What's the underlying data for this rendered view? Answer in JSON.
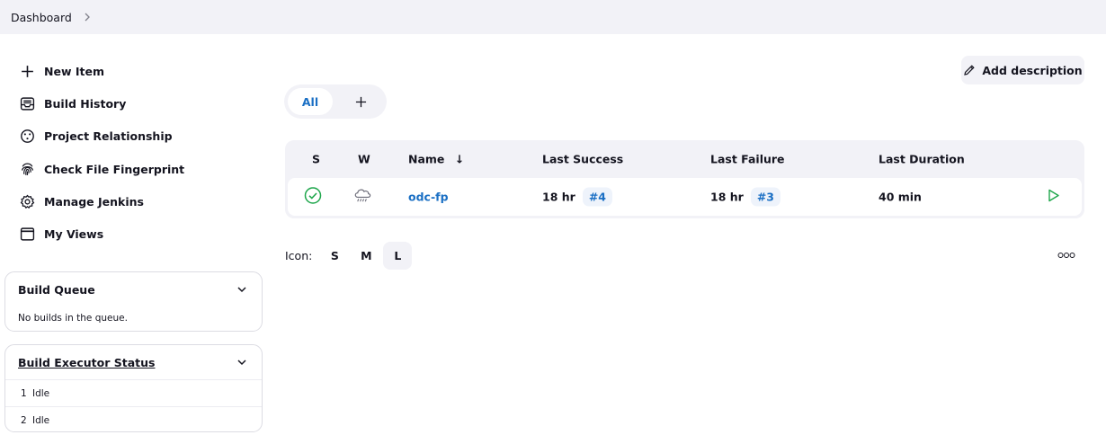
{
  "breadcrumb": {
    "dashboard": "Dashboard"
  },
  "sidebar": {
    "tasks": [
      {
        "label": "New Item",
        "icon": "plus-icon"
      },
      {
        "label": "Build History",
        "icon": "inbox-icon"
      },
      {
        "label": "Project Relationship",
        "icon": "relationship-icon"
      },
      {
        "label": "Check File Fingerprint",
        "icon": "fingerprint-icon"
      },
      {
        "label": "Manage Jenkins",
        "icon": "gear-icon"
      },
      {
        "label": "My Views",
        "icon": "window-icon"
      }
    ],
    "build_queue": {
      "title": "Build Queue",
      "empty_text": "No builds in the queue."
    },
    "executors": {
      "title": "Build Executor Status",
      "items": [
        {
          "num": "1",
          "state": "Idle"
        },
        {
          "num": "2",
          "state": "Idle"
        }
      ]
    }
  },
  "main": {
    "add_description": "Add description",
    "tabs": {
      "all": "All"
    },
    "table": {
      "headers": {
        "s": "S",
        "w": "W",
        "name": "Name",
        "sort": "↓",
        "last_success": "Last Success",
        "last_failure": "Last Failure",
        "last_duration": "Last Duration"
      },
      "rows": [
        {
          "name": "odc-fp",
          "last_success_time": "18 hr",
          "last_success_build": "#4",
          "last_failure_time": "18 hr",
          "last_failure_build": "#3",
          "last_duration": "40 min",
          "status": "success",
          "weather": "rain"
        }
      ]
    },
    "icon_size": {
      "label": "Icon:",
      "options": [
        "S",
        "M",
        "L"
      ],
      "selected": "L"
    }
  },
  "colors": {
    "accent": "#1a6fc4",
    "success": "#1ea64b",
    "panel_bg": "#f2f2f7"
  }
}
